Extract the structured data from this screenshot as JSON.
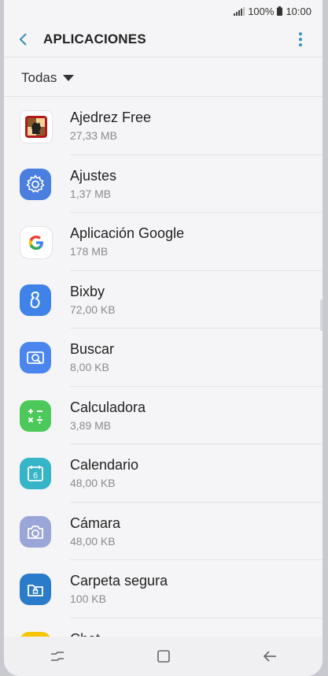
{
  "status_bar": {
    "battery": "100%",
    "time": "10:00"
  },
  "header": {
    "title": "APLICACIONES"
  },
  "filter": {
    "label": "Todas"
  },
  "apps": [
    {
      "name": "Ajedrez Free",
      "size": "27,33 MB",
      "icon": "chess-icon"
    },
    {
      "name": "Ajustes",
      "size": "1,37 MB",
      "icon": "settings-gear-icon"
    },
    {
      "name": "Aplicación Google",
      "size": "178 MB",
      "icon": "google-g-icon"
    },
    {
      "name": "Bixby",
      "size": "72,00 KB",
      "icon": "bixby-icon"
    },
    {
      "name": "Buscar",
      "size": "8,00 KB",
      "icon": "search-icon"
    },
    {
      "name": "Calculadora",
      "size": "3,89 MB",
      "icon": "calculator-icon"
    },
    {
      "name": "Calendario",
      "size": "48,00 KB",
      "icon": "calendar-icon"
    },
    {
      "name": "Cámara",
      "size": "48,00 KB",
      "icon": "camera-icon"
    },
    {
      "name": "Carpeta segura",
      "size": "100 KB",
      "icon": "secure-folder-icon"
    },
    {
      "name": "Chat",
      "size": "",
      "icon": "chat-icon"
    }
  ],
  "colors": {
    "accent": "#3a8fb7",
    "ajustes": "#4a7fe0",
    "bixby": "#3f83e8",
    "buscar": "#4a86ee",
    "calculadora": "#4cc95a",
    "calendario": "#36b4c8",
    "camara": "#9aa6d8",
    "carpeta": "#2a7bc9",
    "chat": "#f7c600"
  }
}
